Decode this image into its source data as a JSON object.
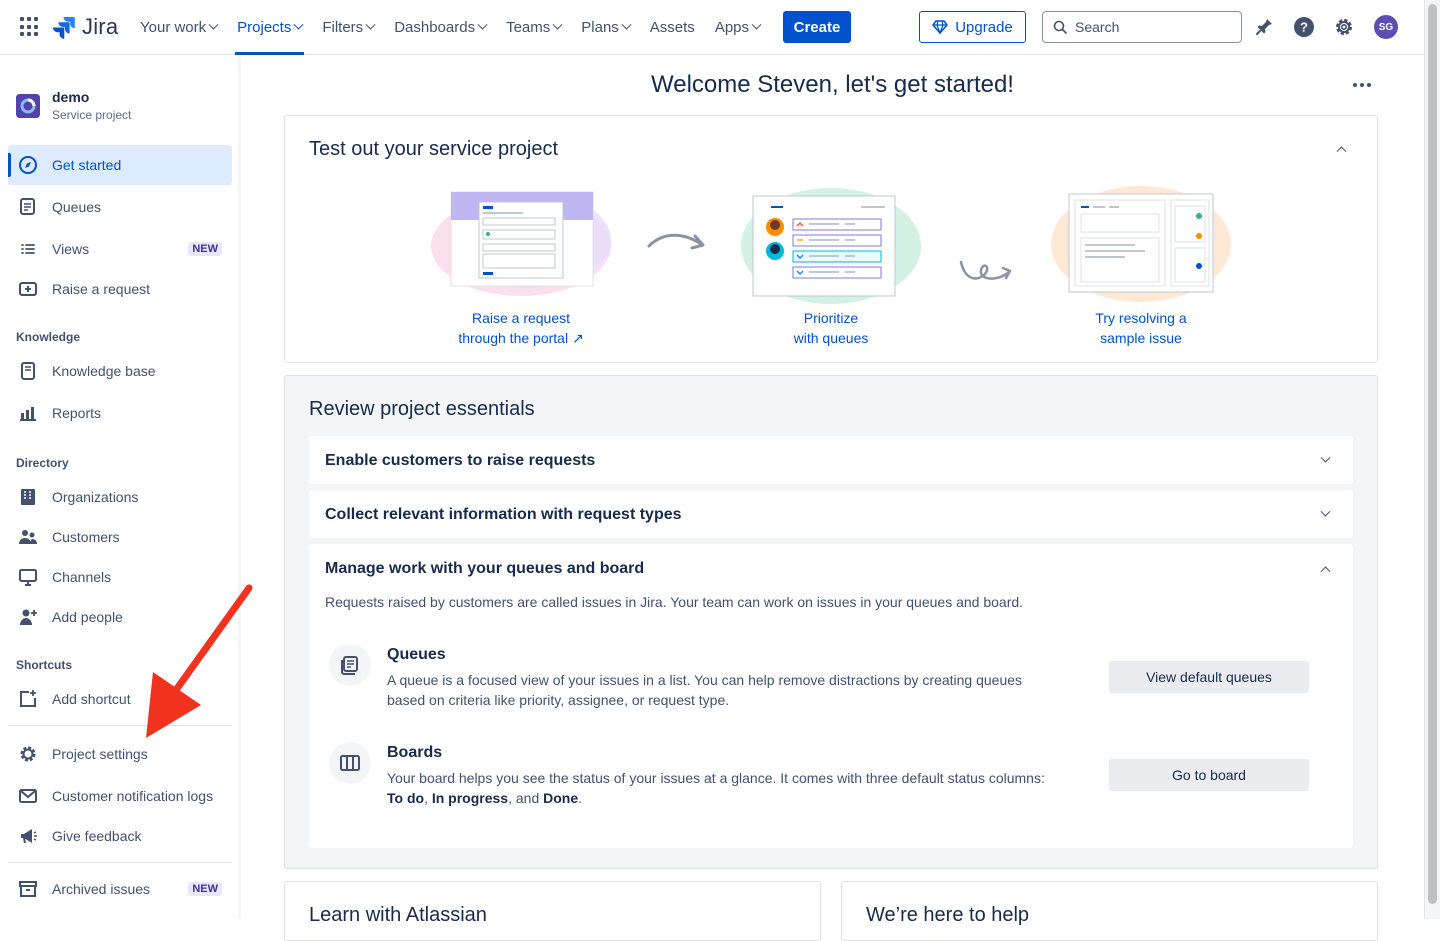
{
  "topbar": {
    "logo_text": "Jira",
    "nav": [
      {
        "label": "Your work",
        "dropdown": true
      },
      {
        "label": "Projects",
        "dropdown": true,
        "active": true
      },
      {
        "label": "Filters",
        "dropdown": true
      },
      {
        "label": "Dashboards",
        "dropdown": true
      },
      {
        "label": "Teams",
        "dropdown": true
      },
      {
        "label": "Plans",
        "dropdown": true
      },
      {
        "label": "Assets",
        "dropdown": false
      },
      {
        "label": "Apps",
        "dropdown": true
      }
    ],
    "create_label": "Create",
    "upgrade_label": "Upgrade",
    "search_placeholder": "Search",
    "avatar_initials": "SG",
    "icons": [
      "notifications-icon",
      "help-icon",
      "settings-icon"
    ]
  },
  "sidebar": {
    "project_name": "demo",
    "project_type": "Service project",
    "items": [
      {
        "label": "Get started",
        "icon": "compass-icon",
        "active": true
      },
      {
        "label": "Queues",
        "icon": "queues-icon"
      },
      {
        "label": "Views",
        "icon": "list-icon",
        "badge": "NEW"
      },
      {
        "label": "Raise a request",
        "icon": "raise-request-icon"
      }
    ],
    "knowledge_heading": "Knowledge",
    "knowledge_items": [
      {
        "label": "Knowledge base",
        "icon": "book-icon"
      },
      {
        "label": "Reports",
        "icon": "reports-icon"
      }
    ],
    "directory_heading": "Directory",
    "directory_items": [
      {
        "label": "Organizations",
        "icon": "building-icon"
      },
      {
        "label": "Customers",
        "icon": "people-icon"
      },
      {
        "label": "Channels",
        "icon": "monitor-icon"
      },
      {
        "label": "Add people",
        "icon": "add-person-icon"
      }
    ],
    "shortcuts_heading": "Shortcuts",
    "shortcut_items": [
      {
        "label": "Add shortcut",
        "icon": "add-shortcut-icon"
      }
    ],
    "footer_items": [
      {
        "label": "Project settings",
        "icon": "gear-icon"
      },
      {
        "label": "Customer notification logs",
        "icon": "mail-icon"
      },
      {
        "label": "Give feedback",
        "icon": "megaphone-icon"
      }
    ],
    "archived": {
      "label": "Archived issues",
      "icon": "archive-icon",
      "badge": "NEW"
    }
  },
  "main": {
    "welcome": "Welcome Steven, let's get started!",
    "test_card": {
      "title": "Test out your service project",
      "steps": [
        {
          "line1": "Raise a request",
          "line2": "through the portal ↗"
        },
        {
          "line1": "Prioritize",
          "line2": "with queues"
        },
        {
          "line1": "Try resolving a",
          "line2": "sample issue"
        }
      ]
    },
    "essentials": {
      "title": "Review project essentials",
      "accordions": [
        {
          "title": "Enable customers to raise requests",
          "expanded": false
        },
        {
          "title": "Collect relevant information with request types",
          "expanded": false
        },
        {
          "title": "Manage work with your queues and board",
          "expanded": true
        }
      ],
      "intro": "Requests raised by customers are called issues in Jira. Your team can work on issues in your queues and board.",
      "features": [
        {
          "title": "Queues",
          "icon": "queues-icon",
          "desc": "A queue is a focused view of your issues in a list. You can help remove distractions by creating queues based on criteria like priority, assignee, or request type.",
          "button": "View default queues"
        },
        {
          "title": "Boards",
          "icon": "board-icon",
          "desc_prefix": "Your board helps you see the status of your issues at a glance. It comes with three default status columns: ",
          "desc_todo": "To do",
          "desc_sep1": ", ",
          "desc_inprogress": "In progress",
          "desc_sep2": ", and ",
          "desc_done": "Done",
          "desc_end": ".",
          "button": "Go to board"
        }
      ]
    },
    "learn_card_title": "Learn with Atlassian",
    "help_card_title": "We’re here to help"
  },
  "colors": {
    "brand": "#0052CC",
    "active_bg": "#DEEBFF",
    "annotation_arrow": "#F0321E"
  }
}
